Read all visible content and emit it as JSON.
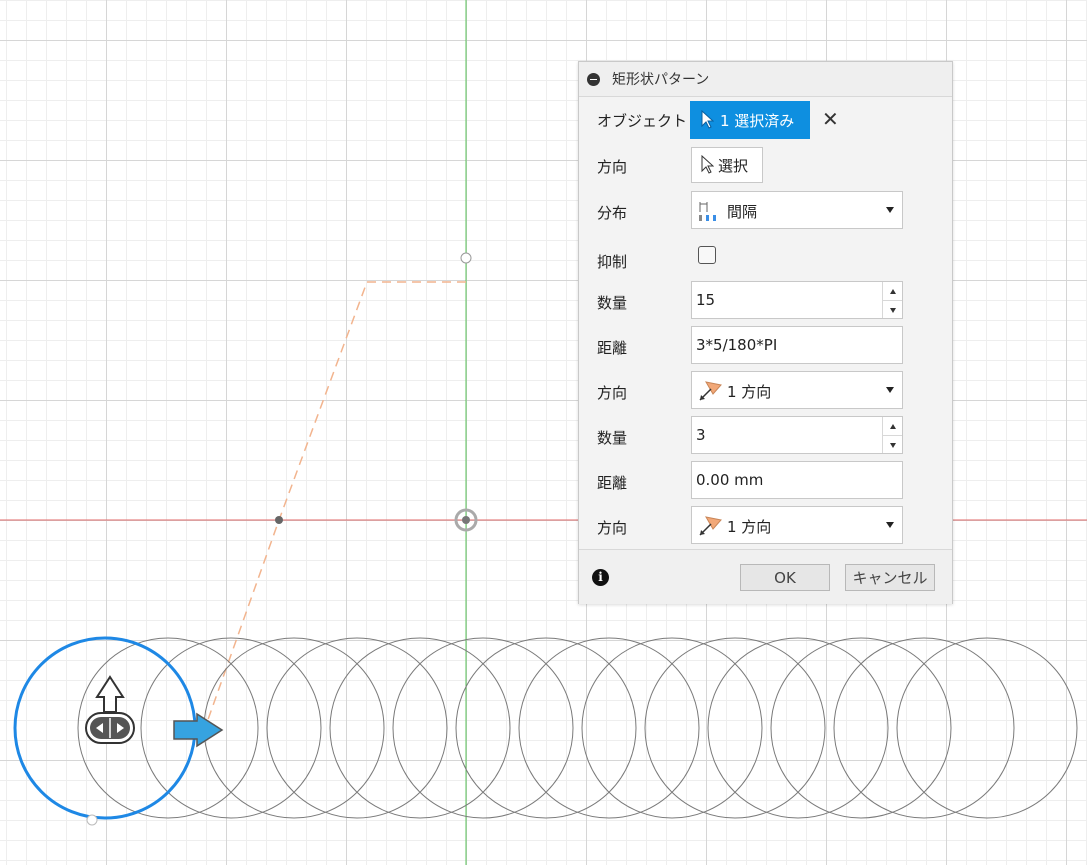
{
  "dialog": {
    "title": "矩形状パターン",
    "rows": {
      "object": {
        "label": "オブジェクト",
        "value": "1 選択済み"
      },
      "direction": {
        "label": "方向",
        "value": "選択"
      },
      "distribution": {
        "label": "分布",
        "value": "間隔"
      },
      "suppress": {
        "label": "抑制",
        "checked": false
      },
      "quantity1": {
        "label": "数量",
        "value": "15"
      },
      "distance1": {
        "label": "距離",
        "value": "3*5/180*PI"
      },
      "direction1": {
        "label": "方向",
        "value": "1 方向"
      },
      "quantity2": {
        "label": "数量",
        "value": "3"
      },
      "distance2": {
        "label": "距離",
        "value": "0.00 mm"
      },
      "direction2": {
        "label": "方向",
        "value": "1 方向"
      }
    },
    "buttons": {
      "ok": "OK",
      "cancel": "キャンセル"
    },
    "icons": {
      "collapse": "minus-circle-icon",
      "cursor": "cursor-icon",
      "clear": "close-icon",
      "spacing": "spacing-icon",
      "direction": "direction-arrow-icon",
      "info": "info-icon"
    }
  },
  "viewport": {
    "colors": {
      "x_axis": "#e06a6a",
      "y_axis": "#59c459",
      "selected_circle": "#1e88e5",
      "pattern_circle": "#7a7a7a",
      "construction_line": "#f2b48e",
      "manipulator_arrow": "#36a3e0"
    },
    "pattern_circle_count": 15
  }
}
